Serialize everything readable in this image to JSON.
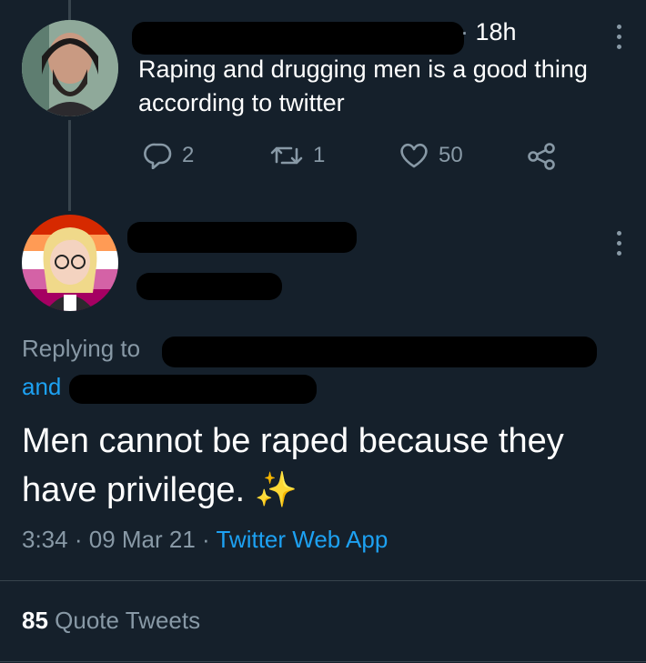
{
  "tweet1": {
    "time": "18h",
    "text": "Raping and drugging men is a good thing according to twitter",
    "replies": "2",
    "retweets": "1",
    "likes": "50"
  },
  "tweet2": {
    "replying_prefix": "Replying to",
    "replying_and": "and",
    "text": "Men cannot be raped because they have privilege. ✨",
    "time": "3:34",
    "date": "09 Mar 21",
    "client": "Twitter Web App",
    "quote_count": "85",
    "quote_label": "Quote Tweets"
  },
  "colors": {
    "background": "#15202b",
    "secondary": "#8899a6",
    "accent": "#1da1f2"
  },
  "icons": [
    "reply-icon",
    "retweet-icon",
    "like-icon",
    "share-icon",
    "more-icon",
    "sparkles-emoji"
  ]
}
